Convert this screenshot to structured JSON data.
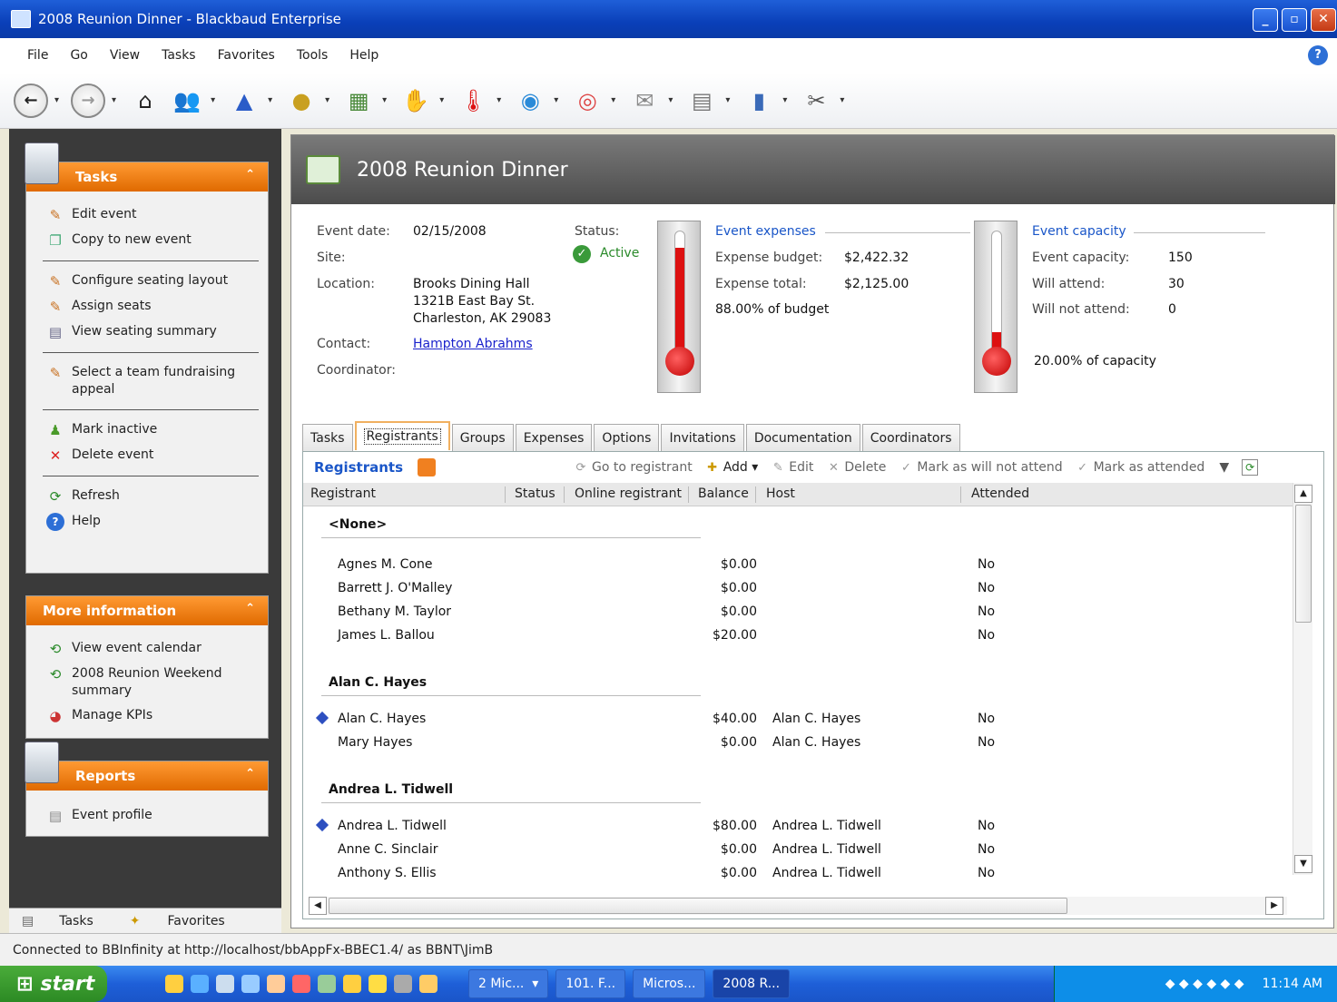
{
  "window": {
    "title": "2008 Reunion Dinner - Blackbaud Enterprise"
  },
  "menu": [
    "File",
    "Go",
    "View",
    "Tasks",
    "Favorites",
    "Tools",
    "Help"
  ],
  "left": {
    "tasks": {
      "title": "Tasks",
      "groups": [
        [
          {
            "label": "Edit event",
            "icon": "pencil-icon"
          },
          {
            "label": "Copy to new event",
            "icon": "copy-icon"
          }
        ],
        [
          {
            "label": "Configure seating layout",
            "icon": "pencil-icon"
          },
          {
            "label": "Assign seats",
            "icon": "pencil-icon"
          },
          {
            "label": "View seating summary",
            "icon": "report-icon"
          }
        ],
        [
          {
            "label": "Select a team fundraising appeal",
            "icon": "pencil-icon"
          }
        ],
        [
          {
            "label": "Mark inactive",
            "icon": "people-icon"
          },
          {
            "label": "Delete event",
            "icon": "delete-icon"
          }
        ],
        [
          {
            "label": "Refresh",
            "icon": "refresh-icon"
          },
          {
            "label": "Help",
            "icon": "help-icon"
          }
        ]
      ]
    },
    "more": {
      "title": "More information",
      "items": [
        {
          "label": "View event calendar"
        },
        {
          "label": "2008 Reunion Weekend summary"
        },
        {
          "label": "Manage KPIs"
        }
      ]
    },
    "reports": {
      "title": "Reports",
      "items": [
        {
          "label": "Event profile"
        }
      ]
    },
    "bottom_tabs": [
      "Tasks",
      "Favorites"
    ]
  },
  "header": {
    "title": "2008 Reunion Dinner"
  },
  "event": {
    "date_label": "Event date:",
    "date": "02/15/2008",
    "site_label": "Site:",
    "location_label": "Location:",
    "location_1": "Brooks Dining Hall",
    "location_2": "1321B East Bay St.",
    "location_3": "Charleston, AK  29083",
    "contact_label": "Contact:",
    "contact": "Hampton Abrahms",
    "coordinator_label": "Coordinator:",
    "status_label": "Status:",
    "status": "Active"
  },
  "expenses": {
    "title": "Event expenses",
    "budget_label": "Expense budget:",
    "budget": "$2,422.32",
    "total_label": "Expense total:",
    "total": "$2,125.00",
    "pct": "88.00% of budget",
    "fill_fraction": 0.88
  },
  "capacity": {
    "title": "Event capacity",
    "cap_label": "Event capacity:",
    "cap": "150",
    "will_label": "Will attend:",
    "will": "30",
    "wont_label": "Will not attend:",
    "wont": "0",
    "pct": "20.00% of capacity",
    "fill_fraction": 0.2
  },
  "tabs": [
    "Tasks",
    "Registrants",
    "Groups",
    "Expenses",
    "Options",
    "Invitations",
    "Documentation",
    "Coordinators"
  ],
  "grid": {
    "title": "Registrants",
    "toolbar": {
      "goto": "Go to registrant",
      "add": "Add",
      "edit": "Edit",
      "delete": "Delete",
      "notattend": "Mark as will not attend",
      "attended": "Mark as attended"
    },
    "columns": {
      "registrant": "Registrant",
      "status": "Status",
      "online": "Online registrant",
      "balance": "Balance",
      "host": "Host",
      "attended": "Attended"
    },
    "groups": [
      {
        "name": "<None>",
        "rows": [
          {
            "name": "Agnes M. Cone",
            "balance": "$0.00",
            "host": "",
            "attended": "No",
            "primary": false
          },
          {
            "name": "Barrett J. O'Malley",
            "balance": "$0.00",
            "host": "",
            "attended": "No",
            "primary": false
          },
          {
            "name": "Bethany M. Taylor",
            "balance": "$0.00",
            "host": "",
            "attended": "No",
            "primary": false
          },
          {
            "name": "James L. Ballou",
            "balance": "$20.00",
            "host": "",
            "attended": "No",
            "primary": false
          }
        ]
      },
      {
        "name": "Alan C. Hayes",
        "rows": [
          {
            "name": "Alan C. Hayes",
            "balance": "$40.00",
            "host": "Alan C. Hayes",
            "attended": "No",
            "primary": true
          },
          {
            "name": "Mary Hayes",
            "balance": "$0.00",
            "host": "Alan C. Hayes",
            "attended": "No",
            "primary": false
          }
        ]
      },
      {
        "name": "Andrea L. Tidwell",
        "rows": [
          {
            "name": "Andrea L. Tidwell",
            "balance": "$80.00",
            "host": "Andrea L. Tidwell",
            "attended": "No",
            "primary": true
          },
          {
            "name": "Anne C. Sinclair",
            "balance": "$0.00",
            "host": "Andrea L. Tidwell",
            "attended": "No",
            "primary": false
          },
          {
            "name": "Anthony S. Ellis",
            "balance": "$0.00",
            "host": "Andrea L. Tidwell",
            "attended": "No",
            "primary": false
          }
        ]
      }
    ]
  },
  "status_bar": "Connected to BBInfinity at http://localhost/bbAppFx-BBEC1.4/ as BBNT\\JimB",
  "taskbar": {
    "start": "start",
    "buttons": [
      "2 Mic...",
      "101. F...",
      "Micros...",
      "2008 R..."
    ],
    "time": "11:14 AM"
  }
}
